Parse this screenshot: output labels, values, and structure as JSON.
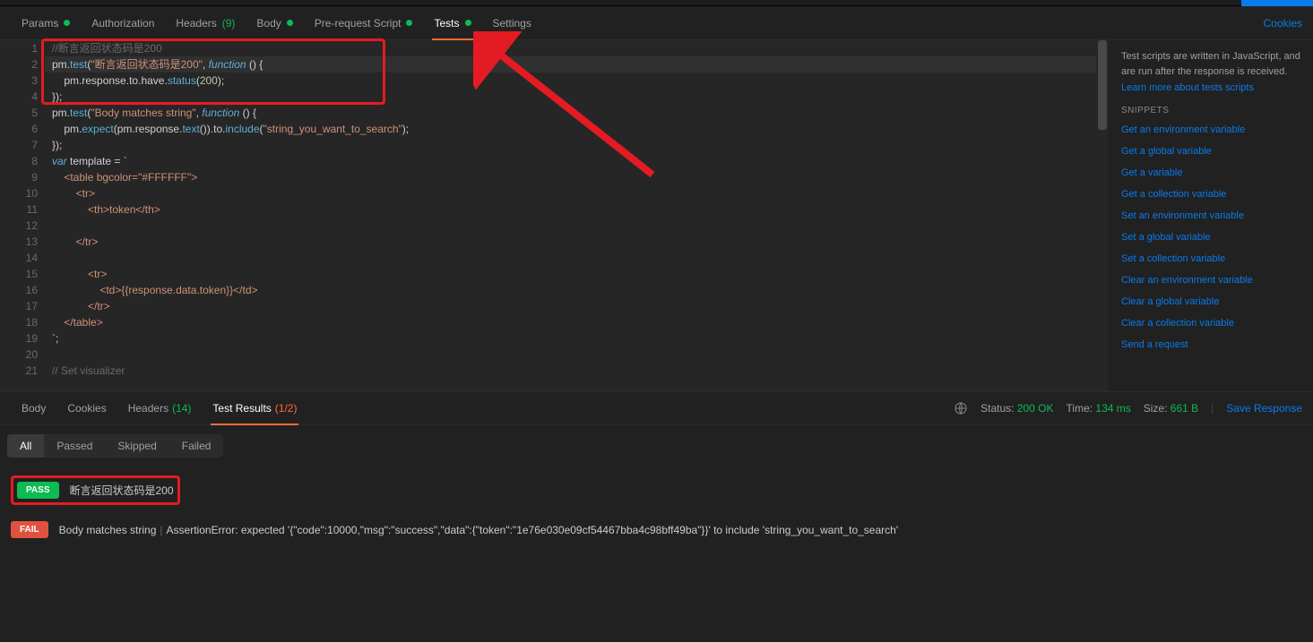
{
  "topTabs": {
    "params": "Params",
    "auth": "Authorization",
    "headers": "Headers ",
    "headersCount": "(9)",
    "body": "Body",
    "preReq": "Pre-request Script",
    "tests": "Tests",
    "settings": "Settings",
    "cookies": "Cookies"
  },
  "code": {
    "l1": "//断言返回状态码是200",
    "l2_pm": "pm",
    "l2_test": "test",
    "l2_str": "\"断言返回状态码是200\"",
    "l2_func": "function",
    "l2_rest": " () {",
    "l3_pre": "    pm",
    "l3_resp": "response",
    "l3_to": "to",
    "l3_have": "have",
    "l3_status": "status",
    "l3_num": "200",
    "l4": "});",
    "l5_pm": "pm",
    "l5_test": "test",
    "l5_str": "\"Body matches string\"",
    "l5_func": "function",
    "l5_rest": " () {",
    "l6_pre": "    pm",
    "l6_expect": "expect",
    "l6_pmresp": "pm",
    "l6_resp": "response",
    "l6_text": "text",
    "l6_to": "to",
    "l6_include": "include",
    "l6_str": "\"string_you_want_to_search\"",
    "l7": "});",
    "l8_var": "var",
    "l8_rest": " template = `",
    "l9": "    <table bgcolor=\"#FFFFFF\">",
    "l10": "        <tr>",
    "l11": "            <th>token</th>",
    "l12": "",
    "l13": "        </tr>",
    "l14": "",
    "l15": "            <tr>",
    "l16": "                <td>{{response.data.token}}</td>",
    "l17": "            </tr>",
    "l18": "    </table>",
    "l19": "`;",
    "l20": "",
    "l21": "// Set visualizer"
  },
  "sidebar": {
    "desc": "Test scripts are written in JavaScript, and are run after the response is received.",
    "learn": "Learn more about tests scripts",
    "snippetsHeader": "SNIPPETS",
    "snippets": [
      "Get an environment variable",
      "Get a global variable",
      "Get a variable",
      "Get a collection variable",
      "Set an environment variable",
      "Set a global variable",
      "Set a collection variable",
      "Clear an environment variable",
      "Clear a global variable",
      "Clear a collection variable",
      "Send a request"
    ]
  },
  "responseTabs": {
    "body": "Body",
    "cookies": "Cookies",
    "headers": "Headers ",
    "headersCount": "(14)",
    "testResults": "Test Results ",
    "testResultsCount": "(1/2)"
  },
  "responseMeta": {
    "statusLabel": "Status: ",
    "statusVal": "200 OK",
    "timeLabel": "Time: ",
    "timeVal": "134 ms",
    "sizeLabel": "Size: ",
    "sizeVal": "661 B",
    "save": "Save Response"
  },
  "filters": {
    "all": "All",
    "passed": "Passed",
    "skipped": "Skipped",
    "failed": "Failed"
  },
  "results": {
    "pass": "PASS",
    "passText": "断言返回状态码是200",
    "fail": "FAIL",
    "failName": "Body matches string",
    "failMsg": "AssertionError: expected '{\"code\":10000,\"msg\":\"success\",\"data\":{\"token\":\"1e76e030e09cf54467bba4c98bff49ba\"}}' to include 'string_you_want_to_search'"
  }
}
